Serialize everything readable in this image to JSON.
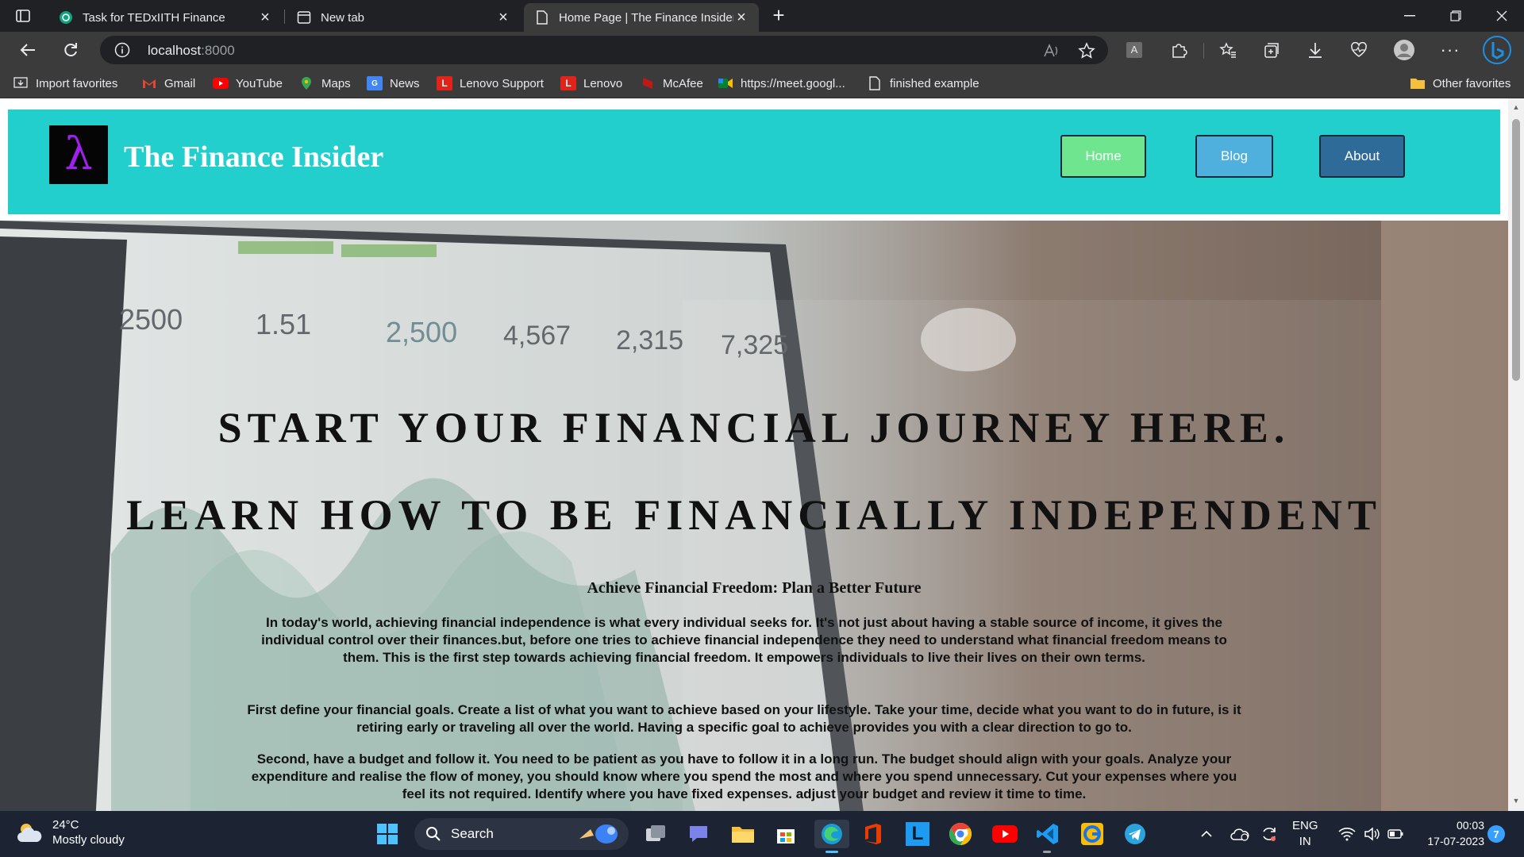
{
  "browser": {
    "tabs": [
      {
        "title": "Task for TEDxIITH Finance",
        "icon": "chatgpt-icon",
        "active": false
      },
      {
        "title": "New tab",
        "icon": "newtab-icon",
        "active": false
      },
      {
        "title": "Home Page | The Finance Insider",
        "icon": "page-icon",
        "active": true
      }
    ],
    "address": {
      "host": "localhost",
      "port": ":8000"
    },
    "bookmarks": [
      {
        "label": "Import favorites",
        "icon": "import-icon"
      },
      {
        "label": "Gmail",
        "icon": "gmail-icon"
      },
      {
        "label": "YouTube",
        "icon": "youtube-icon"
      },
      {
        "label": "Maps",
        "icon": "maps-icon"
      },
      {
        "label": "News",
        "icon": "news-icon"
      },
      {
        "label": "Lenovo Support",
        "icon": "lenovo-icon"
      },
      {
        "label": "Lenovo",
        "icon": "lenovo-icon"
      },
      {
        "label": "McAfee",
        "icon": "mcafee-icon"
      },
      {
        "label": "https://meet.googl...",
        "icon": "meet-icon"
      },
      {
        "label": "finished example",
        "icon": "page-icon"
      }
    ],
    "other_favorites": "Other favorites",
    "read_aloud_label": "A"
  },
  "site": {
    "title": "The Finance Insider",
    "logo_glyph": "λ",
    "nav": {
      "home": "Home",
      "blog": "Blog",
      "about": "About"
    },
    "colors": {
      "header_bg": "#22cfcc",
      "home_btn": "#6ee58e",
      "blog_btn": "#4fb0de",
      "about_btn": "#2e6b99"
    }
  },
  "hero": {
    "headline1": "START YOUR FINANCIAL JOURNEY HERE.",
    "headline2": "LEARN HOW TO BE FINANCIALLY INDEPENDENT",
    "subheading": "Achieve Financial Freedom: Plan a Better Future",
    "paragraphs": [
      "In today's world, achieving financial independence is what every individual seeks for. It's not just about having a stable source of income, it gives the individual control over their finances.but, before one tries to achieve financial independence they need to understand what financial freedom means to them. This is the first step towards achieving financial freedom. It empowers individuals to live their lives on their own terms.",
      "First define your financial goals. Create a list of what you want to achieve based on your lifestyle. Take your time, decide what you want to do in future, is it retiring early or traveling all over the world. Having a specific goal to achieve provides you with a clear direction to go to.",
      "Second, have a budget and follow it. You need to be patient as you have to follow it in a long run. The budget should align with your goals. Analyze your expenditure and realise the flow of money, you should know where you spend the most and where you spend unnecessary. Cut your expenses where you feel its not required. Identify where you have fixed expenses. adjust your budget and review it time to time."
    ],
    "dashboard_numbers": [
      "2500",
      "1.51",
      "2,500",
      "4,567",
      "2,315",
      "7,325"
    ]
  },
  "taskbar": {
    "weather_temp": "24°C",
    "weather_desc": "Mostly cloudy",
    "search_label": "Search",
    "lang1": "ENG",
    "lang2": "IN",
    "time": "00:03",
    "date": "17-07-2023",
    "notifications": "7"
  }
}
